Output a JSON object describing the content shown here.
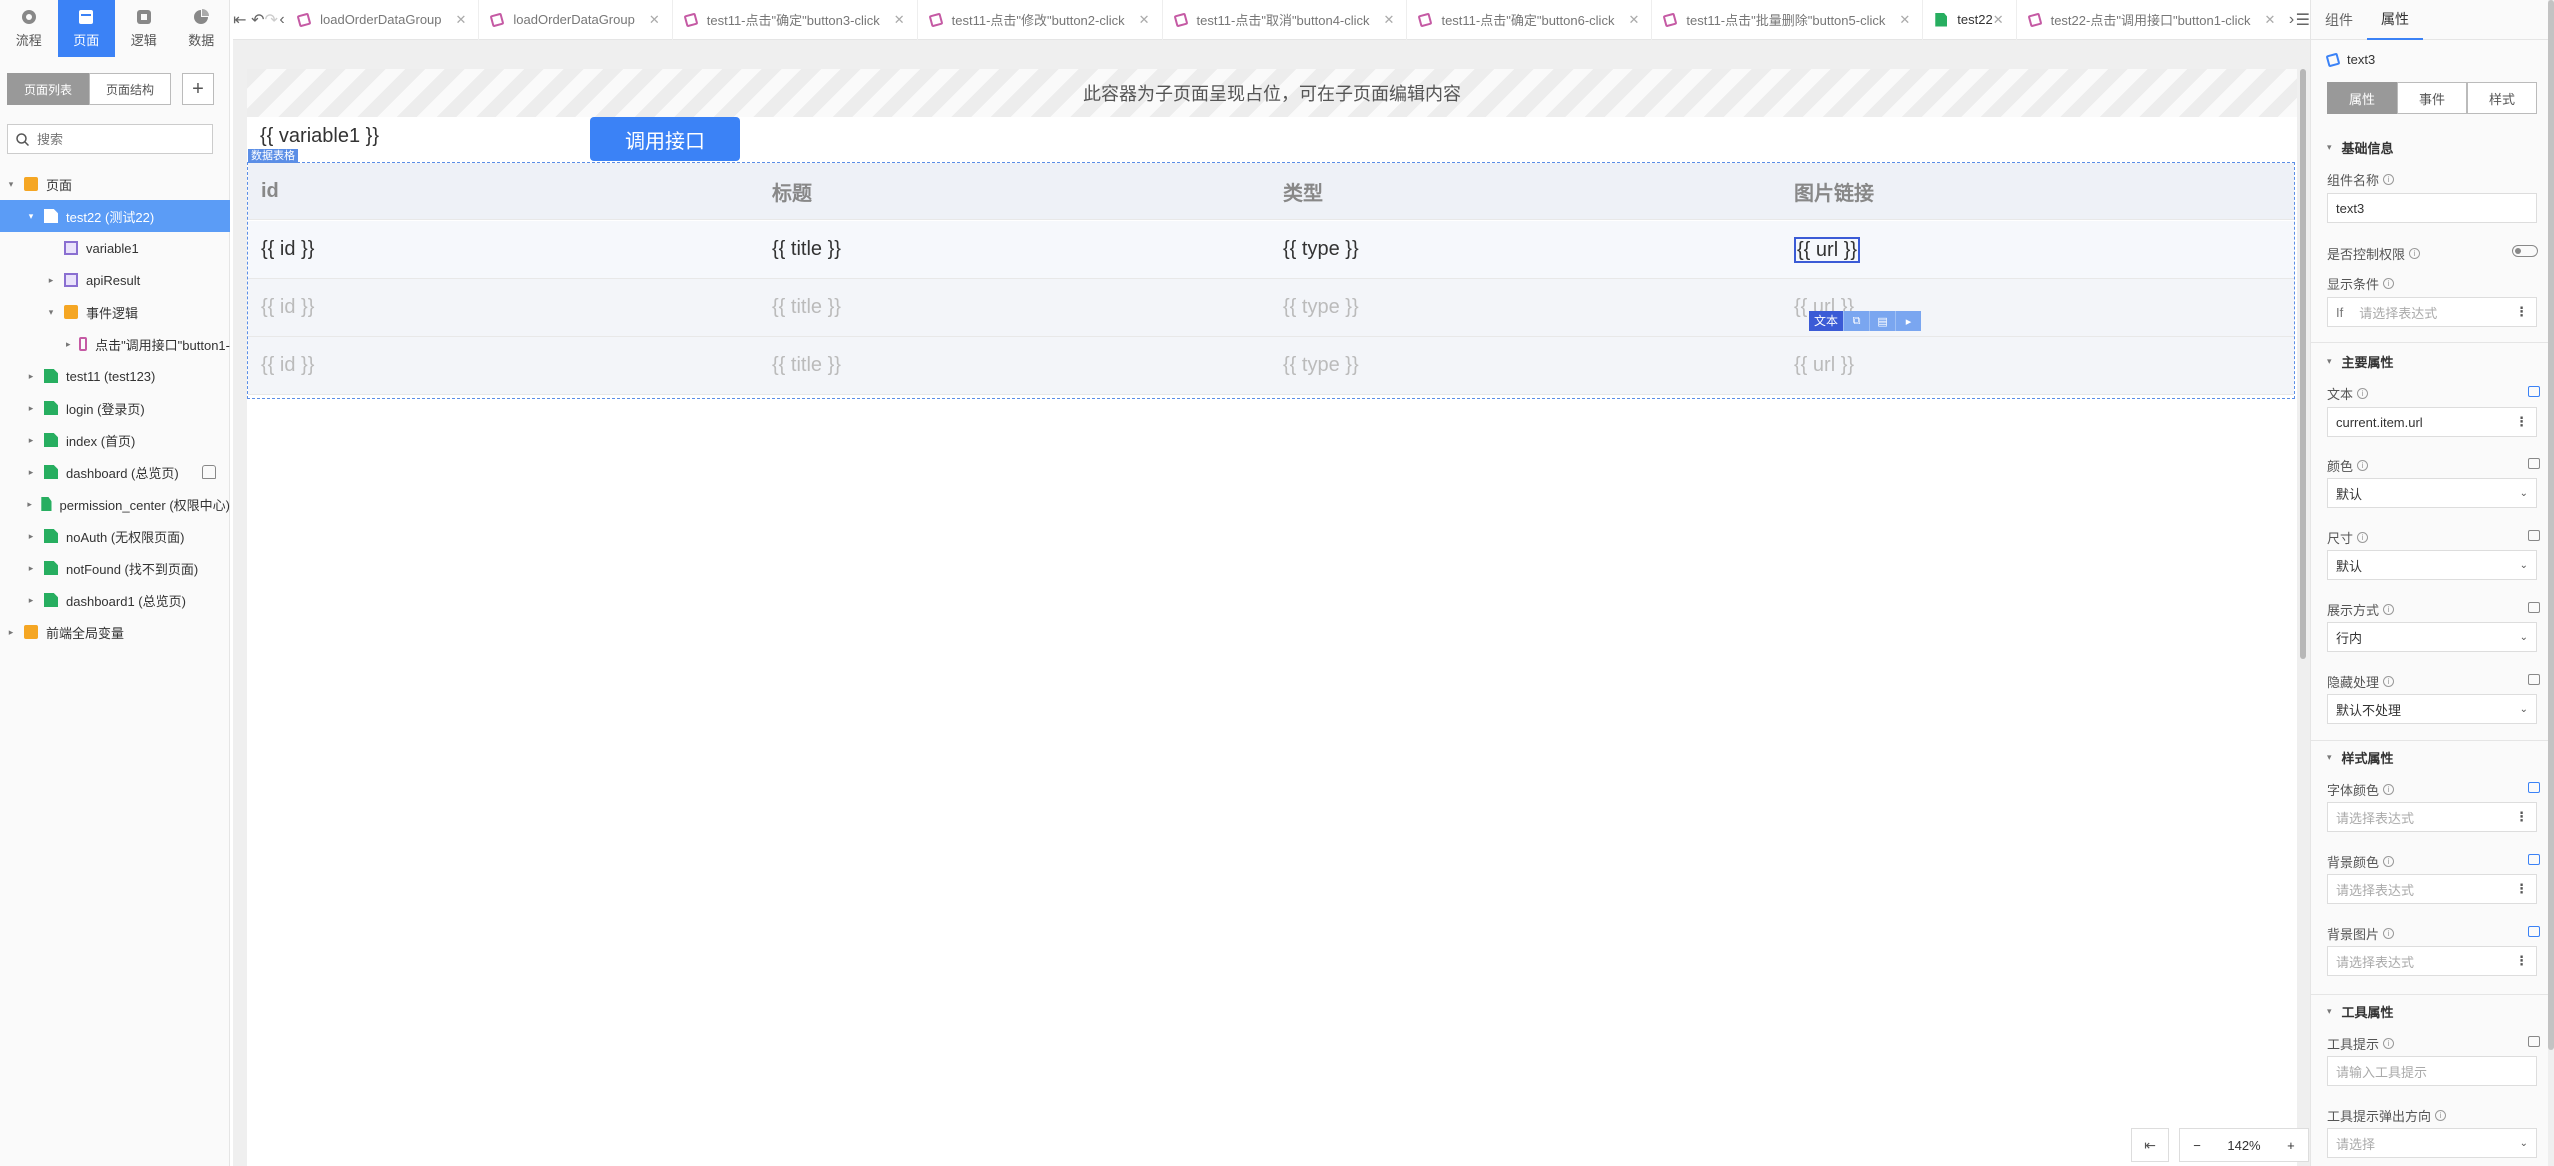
{
  "left": {
    "modes": [
      {
        "label": "流程",
        "icon": "flow-icon"
      },
      {
        "label": "页面",
        "icon": "page-icon"
      },
      {
        "label": "逻辑",
        "icon": "logic-icon"
      },
      {
        "label": "数据",
        "icon": "data-icon"
      }
    ],
    "segments": [
      "页面列表",
      "页面结构"
    ],
    "search_placeholder": "搜索",
    "tree": [
      {
        "label": "页面",
        "icon": "folder"
      },
      {
        "label": "test22 (测试22)",
        "icon": "file"
      },
      {
        "label": "variable1",
        "icon": "var"
      },
      {
        "label": "apiResult",
        "icon": "var"
      },
      {
        "label": "事件逻辑",
        "icon": "folder"
      },
      {
        "label": "点击\"调用接口\"button1-",
        "icon": "flow"
      },
      {
        "label": "test11 (test123)",
        "icon": "file"
      },
      {
        "label": "login (登录页)",
        "icon": "file"
      },
      {
        "label": "index (首页)",
        "icon": "file"
      },
      {
        "label": "dashboard (总览页)",
        "icon": "file"
      },
      {
        "label": "permission_center (权限中心)",
        "icon": "file"
      },
      {
        "label": "noAuth (无权限页面)",
        "icon": "file"
      },
      {
        "label": "notFound (找不到页面)",
        "icon": "file"
      },
      {
        "label": "dashboard1 (总览页)",
        "icon": "file"
      },
      {
        "label": "前端全局变量",
        "icon": "folder"
      }
    ]
  },
  "tabs": [
    {
      "label": "loadOrderDataGroup",
      "type": "flow"
    },
    {
      "label": "loadOrderDataGroup",
      "type": "flow"
    },
    {
      "label": "test11-点击\"确定\"button3-click",
      "type": "flow"
    },
    {
      "label": "test11-点击\"修改\"button2-click",
      "type": "flow"
    },
    {
      "label": "test11-点击\"取消\"button4-click",
      "type": "flow"
    },
    {
      "label": "test11-点击\"确定\"button6-click",
      "type": "flow"
    },
    {
      "label": "test11-点击\"批量删除\"button5-click",
      "type": "flow"
    },
    {
      "label": "test22",
      "type": "page"
    },
    {
      "label": "test22-点击\"调用接口\"button1-click",
      "type": "flow"
    }
  ],
  "stage": {
    "placeholder_text": "此容器为子页面呈现占位，可在子页面编辑内容",
    "variable_text": "{{ variable1 }}",
    "call_button": "调用接口",
    "table_tag": "数据表格",
    "headers": [
      "id",
      "标题",
      "类型",
      "图片链接"
    ],
    "rows": [
      [
        "{{ id }}",
        "{{ title }}",
        "{{ type }}",
        "{{ url }}"
      ],
      [
        "{{ id }}",
        "{{ title }}",
        "{{ type }}",
        "{{ url }}"
      ],
      [
        "{{ id }}",
        "{{ title }}",
        "{{ type }}",
        "{{ url }}"
      ]
    ],
    "text_tag": "文本",
    "zoom": "142%"
  },
  "right": {
    "tabs": [
      "组件",
      "属性"
    ],
    "component_name": "text3",
    "segments": [
      "属性",
      "事件",
      "样式"
    ],
    "sec_basic": "基础信息",
    "lbl_name": "组件名称",
    "val_name": "text3",
    "lbl_perm": "是否控制权限",
    "lbl_show": "显示条件",
    "if_label": "If",
    "ph_expr": "请选择表达式",
    "sec_main": "主要属性",
    "lbl_text": "文本",
    "val_text": "current.item.url",
    "lbl_color": "颜色",
    "val_color": "默认",
    "lbl_size": "尺寸",
    "val_size": "默认",
    "lbl_display": "展示方式",
    "val_display": "行内",
    "lbl_hide": "隐藏处理",
    "val_hide": "默认不处理",
    "sec_style": "样式属性",
    "lbl_fcolor": "字体颜色",
    "lbl_bgcolor": "背景颜色",
    "lbl_bgimg": "背景图片",
    "sec_tool": "工具属性",
    "lbl_tip": "工具提示",
    "ph_tip": "请输入工具提示",
    "lbl_tipdir": "工具提示弹出方向",
    "ph_select": "请选择"
  }
}
